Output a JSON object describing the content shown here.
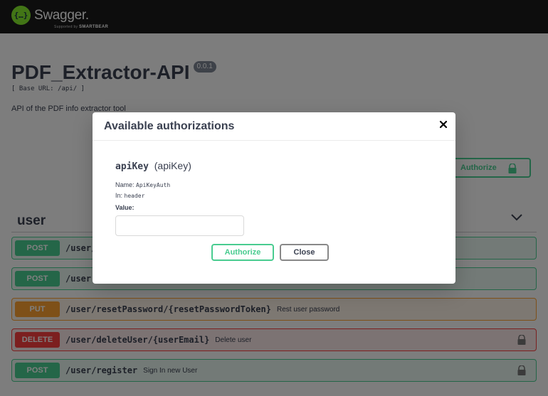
{
  "topbar": {
    "logo_mark": "{…}",
    "logo_name": "Swagger.",
    "logo_sub_prefix": "Supported by",
    "logo_sub_brand": "SMARTBEAR"
  },
  "info": {
    "title": "PDF_Extractor-API",
    "version": "0.0.1",
    "base_url": "[ Base URL: /api/ ]",
    "description": "API of the PDF info extractor tool"
  },
  "authorize_button": {
    "label": "Authorize",
    "icon": "lock-icon"
  },
  "tag": {
    "name": "user",
    "chevron": "chevron-down-icon"
  },
  "operations": [
    {
      "method": "POST",
      "path": "/user/",
      "summary": "",
      "locked": false
    },
    {
      "method": "POST",
      "path": "/user",
      "summary": "",
      "locked": false
    },
    {
      "method": "PUT",
      "path": "/user/resetPassword/{resetPasswordToken}",
      "summary": "Rest user password",
      "locked": false
    },
    {
      "method": "DELETE",
      "path": "/user/deleteUser/{userEmail}",
      "summary": "Delete user",
      "locked": true
    },
    {
      "method": "POST",
      "path": "/user/register",
      "summary": "Sign In new User",
      "locked": true
    }
  ],
  "modal": {
    "title": "Available authorizations",
    "close_icon": "close-icon",
    "scheme_name": "apiKey",
    "scheme_type": "(apiKey)",
    "name_label": "Name:",
    "name_value": "ApiKeyAuth",
    "in_label": "In:",
    "in_value": "header",
    "value_label": "Value:",
    "value_input": "",
    "authorize_label": "Authorize",
    "close_label": "Close"
  },
  "colors": {
    "post": "#49cc90",
    "put": "#fca130",
    "delete": "#f93e3e",
    "topbar": "#1b1b1b"
  }
}
